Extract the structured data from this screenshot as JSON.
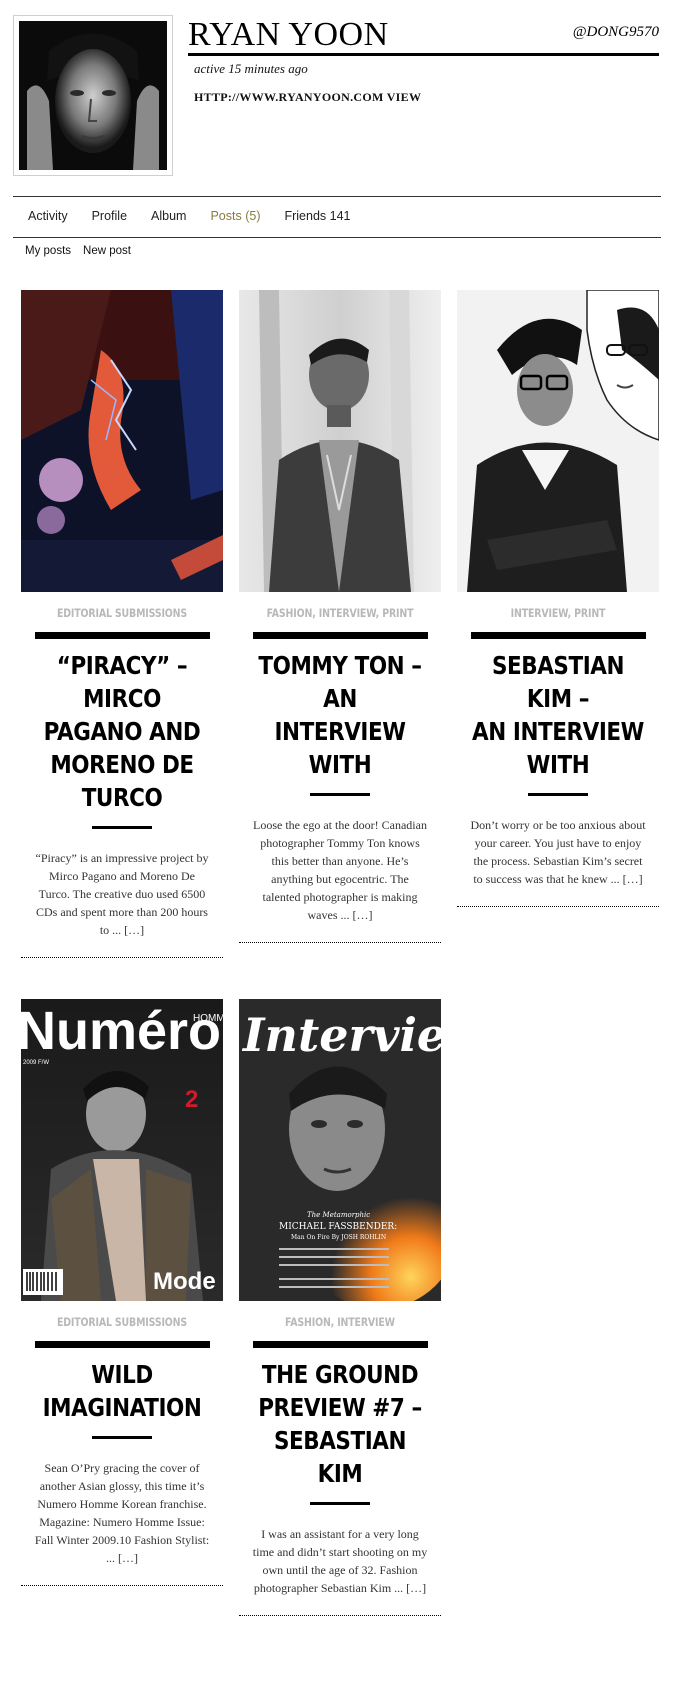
{
  "profile": {
    "name": "RYAN YOON",
    "handle": "@DONG9570",
    "active": "active 15 minutes ago",
    "website": "HTTP://WWW.RYANYOON.COM",
    "website_action": "VIEW"
  },
  "tabs": [
    {
      "label": "Activity"
    },
    {
      "label": "Profile"
    },
    {
      "label": "Album"
    },
    {
      "label": "Posts (5)"
    },
    {
      "label": "Friends 141"
    }
  ],
  "subnav": {
    "my_posts": "My posts",
    "new_post": "New post"
  },
  "posts": [
    {
      "category": "EDITORIAL SUBMISSIONS",
      "title": "“PIRACY” – MIRCO\nPAGANO AND\nMORENO DE TURCO",
      "excerpt": "“Piracy” is an impressive project by Mirco Pagano and Moreno De Turco. The creative duo used 6500 CDs and spent more than 200 hours to ...",
      "more": "[…]"
    },
    {
      "category": "FASHION, INTERVIEW, PRINT",
      "title": "TOMMY TON – AN\nINTERVIEW WITH",
      "excerpt": "Loose the ego at the door! Canadian photographer Tommy Ton knows this better than anyone. He’s anything but egocentric. The talented photographer is making waves ...",
      "more": "[…]"
    },
    {
      "category": "INTERVIEW, PRINT",
      "title": "SEBASTIAN KIM –\nAN INTERVIEW WITH",
      "excerpt": "Don’t worry or be too anxious about your career. You just have to enjoy the process. Sebastian Kim’s secret to success was that he knew ...",
      "more": "[…]"
    },
    {
      "category": "EDITORIAL SUBMISSIONS",
      "title": "WILD IMAGINATION",
      "excerpt": "Sean O’Pry gracing the cover of another Asian glossy, this time it’s Numero Homme Korean franchise. Magazine: Numero Homme Issue: Fall Winter 2009.10 Fashion Stylist: ...",
      "more": "[…]"
    },
    {
      "category": "FASHION, INTERVIEW",
      "title": "THE GROUND\nPREVIEW #7 –\nSEBASTIAN KIM",
      "excerpt": "I was an assistant for a very long time and didn’t start shooting on my own until the age of 32. Fashion photographer Sebastian Kim ...",
      "more": "[…]"
    }
  ],
  "covers": {
    "numero": {
      "masthead": "Numéro",
      "sub": "HOMME",
      "issue": "2",
      "season": "2009 F/W",
      "coverline": "Mode"
    },
    "interview": {
      "masthead": "Interview",
      "kicker": "The Metamorphic",
      "headline": "MICHAEL FASSBENDER:",
      "subline": "Man On Fire By JOSH ROHLIN"
    }
  }
}
